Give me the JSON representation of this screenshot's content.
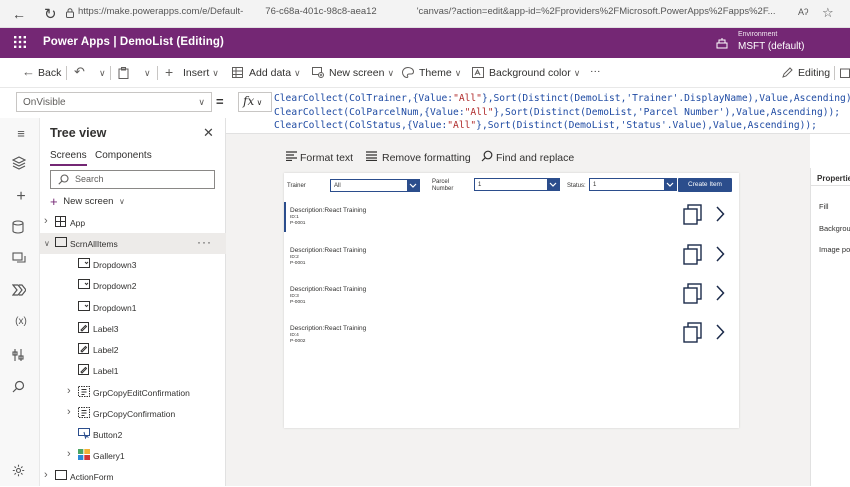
{
  "browser": {
    "url_start": "https://make.powerapps.com/e/Default-",
    "url_mid": "76-c68a-401c-98c8-aea12",
    "url_end": "'canvas/?action=edit&app-id=%2Fproviders%2FMicrosoft.PowerApps%2Fapps%2F...",
    "reader_icon": "Aʔ"
  },
  "header": {
    "title": "Power Apps  |  DemoList (Editing)",
    "environment_label": "Environment",
    "environment_value": "MSFT (default)"
  },
  "commandbar": {
    "back": "Back",
    "insert": "Insert",
    "add_data": "Add data",
    "new_screen": "New screen",
    "theme": "Theme",
    "background_color": "Background color",
    "more": "···",
    "editing": "Editing"
  },
  "formulabar": {
    "property": "OnVisible",
    "equals": "=",
    "fx": "fx",
    "lines": [
      [
        "ClearCollect(ColTrainer,{Value:",
        "\"All\"",
        "},Sort(Distinct(DemoList,'Trainer'.DisplayName),Value,Ascending));"
      ],
      [
        "ClearCollect(ColParcelNum,{Value:",
        "\"All\"",
        "},Sort(Distinct(DemoList,'Parcel Number'),Value,Ascending));"
      ],
      [
        "ClearCollect(ColStatus,{Value:",
        "\"All\"",
        "},Sort(Distinct(DemoList,'Status'.Value),Value,Ascending));"
      ]
    ]
  },
  "treeview": {
    "title": "Tree view",
    "tab_screens": "Screens",
    "tab_components": "Components",
    "search_placeholder": "Search",
    "new_screen": "New screen",
    "nodes": [
      {
        "label": "App"
      },
      {
        "label": "ScrnAllItems"
      },
      {
        "label": "Dropdown3"
      },
      {
        "label": "Dropdown2"
      },
      {
        "label": "Dropdown1"
      },
      {
        "label": "Label3"
      },
      {
        "label": "Label2"
      },
      {
        "label": "Label1"
      },
      {
        "label": "GrpCopyEditConfirmation"
      },
      {
        "label": "GrpCopyConfirmation"
      },
      {
        "label": "Button2"
      },
      {
        "label": "Gallery1"
      },
      {
        "label": "ActionForm"
      }
    ]
  },
  "texttools": {
    "format_text": "Format text",
    "remove_formatting": "Remove formatting",
    "find_replace": "Find and replace"
  },
  "app": {
    "trainer_label": "Trainer",
    "trainer_value": "All",
    "parcel_label_1": "Parcel",
    "parcel_label_2": "Number",
    "parcel_value": "1",
    "status_label": "Status:",
    "status_value": "1",
    "create_button": "Create Item",
    "gallery": [
      {
        "desc": "Description:React Training",
        "id": "ID:1",
        "pn": "P-0001"
      },
      {
        "desc": "Description:React Training",
        "id": "ID:2",
        "pn": "P-0001"
      },
      {
        "desc": "Description:React Training",
        "id": "ID:3",
        "pn": "P-0001"
      },
      {
        "desc": "Description:React Training",
        "id": "ID:4",
        "pn": "P-0002"
      }
    ]
  },
  "properties": {
    "title": "Properties",
    "fill": "Fill",
    "background": "Backgrou",
    "image_position": "Image po"
  },
  "colors": {
    "header_purple": "#742774",
    "app_blue": "#2b4d8c",
    "formula_blue": "#1f4ba3",
    "formula_string": "#b02c2c"
  }
}
